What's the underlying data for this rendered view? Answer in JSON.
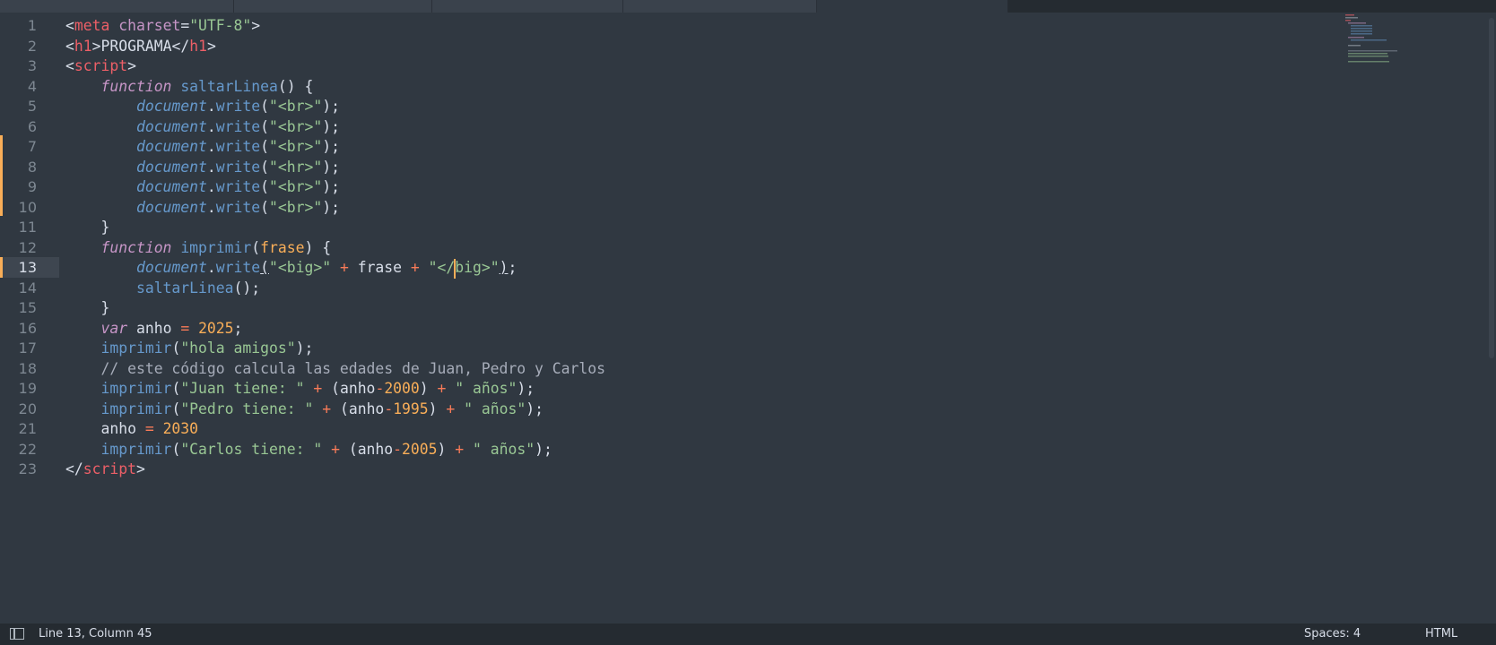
{
  "editor": {
    "line_numbers": [
      "1",
      "2",
      "3",
      "4",
      "5",
      "6",
      "7",
      "8",
      "9",
      "10",
      "11",
      "12",
      "13",
      "14",
      "15",
      "16",
      "17",
      "18",
      "19",
      "20",
      "21",
      "22",
      "23"
    ],
    "current_line": "13"
  },
  "status": {
    "position": "Line 13, Column 45",
    "spaces": "Spaces: 4",
    "syntax": "HTML"
  },
  "icons": {
    "sidebar_toggle": "sidebar-toggle-icon"
  },
  "colors": {
    "background": "#303841",
    "status_bar": "#252b31",
    "modified_marker": "#f9ae58"
  }
}
